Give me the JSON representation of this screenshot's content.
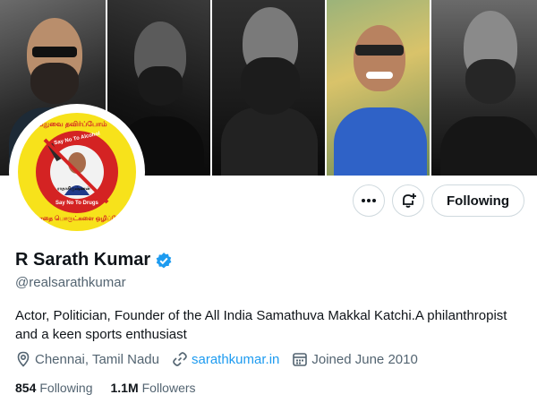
{
  "profile": {
    "name": "R Sarath Kumar",
    "handle": "@realsarathkumar",
    "bio": "Actor, Politician, Founder of the All India Samathuva Makkal Katchi.A philanthropist and a keen sports enthusiast",
    "location": "Chennai, Tamil Nadu",
    "website": "sarathkumar.in",
    "joined": "Joined June 2010",
    "verified_badge_color": "#1d9bf0"
  },
  "actions": {
    "follow_label": "Following"
  },
  "stats": {
    "following_count": "854",
    "following_label": "Following",
    "followers_count": "1.1M",
    "followers_label": "Followers"
  },
  "avatar": {
    "text_top": "மதுவை தவிர்ப்போம்",
    "text_say1": "Say No To Alcohol",
    "text_mid": "ராதாகிருஷ்ணன்",
    "text_say2": "Say No To Drugs",
    "text_bottom": "போதை பொருட்களை ஒழிப்போம்"
  },
  "icons": {
    "more": "more-icon",
    "notify": "notification-bell-plus-icon",
    "location": "location-pin-icon",
    "link": "link-icon",
    "calendar": "calendar-icon",
    "verified": "verified-badge-icon"
  }
}
